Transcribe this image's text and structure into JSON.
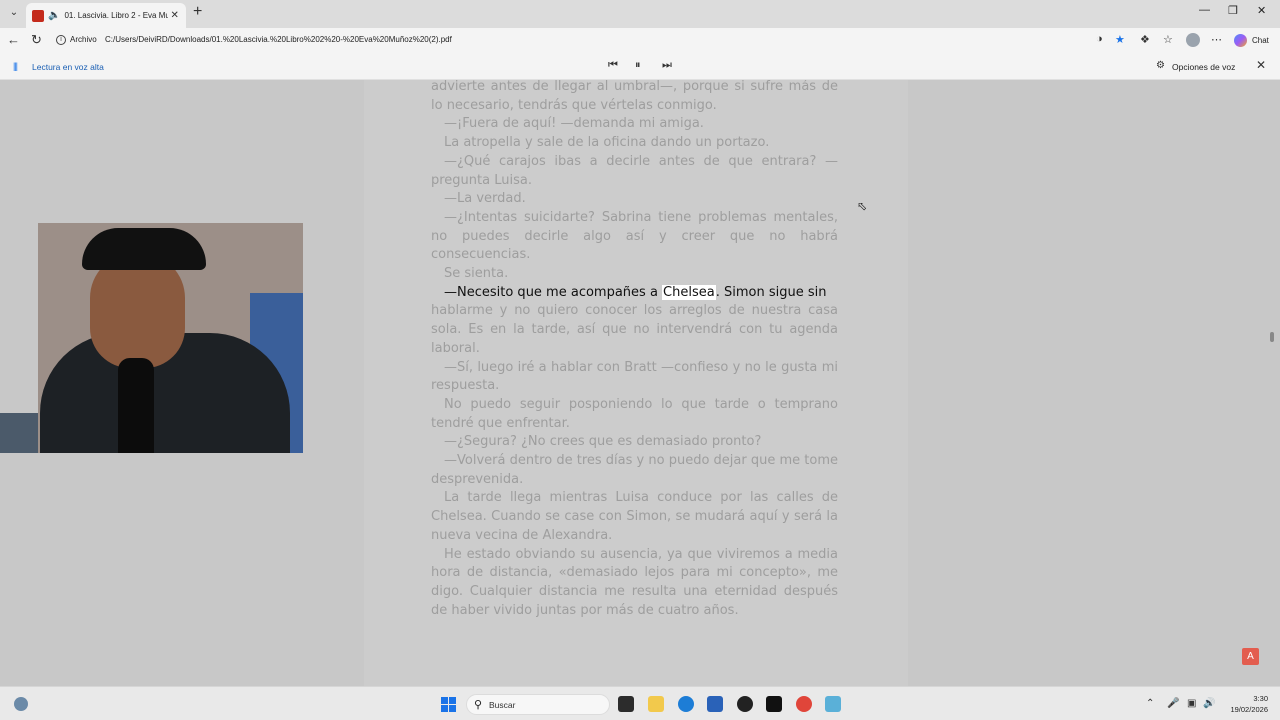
{
  "browser": {
    "tab_title": "01. Lascivia. Libro 2 - Eva Muñ",
    "address_label": "Archivo",
    "url": "C:/Users/DeiviRD/Downloads/01.%20Lascivia.%20Libro%202%20-%20Eva%20Muñoz%20(2).pdf",
    "chat_label": "Chat"
  },
  "read_aloud": {
    "label": "Lectura en voz alta",
    "voice_options": "Opciones de voz"
  },
  "page": {
    "paragraphs": [
      "advierte antes de llegar al umbral—, porque si sufre más de lo necesario, tendrás que vértelas conmigo.",
      "—¡Fuera de aquí! —demanda mi amiga.",
      "La atropella y sale de la oficina dando un portazo.",
      "—¿Qué carajos ibas a decirle antes de que entrara? —pregunta Luisa.",
      "—La verdad.",
      "—¿Intentas suicidarte? Sabrina tiene problemas mentales, no puedes decirle algo así y creer que no habrá consecuencias.",
      "Se sienta."
    ],
    "active_before": "—Necesito que me acompañes a ",
    "active_word": "Chelsea",
    "active_after": ". Simon sigue sin",
    "active_rest": "hablarme y no quiero conocer los arreglos de nuestra casa sola. Es en la tarde, así que no intervendrá con tu agenda laboral.",
    "paragraphs_after": [
      "—Sí, luego iré a hablar con Bratt —confieso y no le gusta mi respuesta.",
      "No puedo seguir posponiendo lo que tarde o temprano tendré que enfrentar.",
      "—¿Segura? ¿No crees que es demasiado pronto?",
      "—Volverá dentro de tres días y no puedo dejar que me tome desprevenida.",
      "La tarde llega mientras Luisa conduce por las calles de Chelsea. Cuando se case con Simon, se mudará aquí y será la nueva vecina de Alexandra.",
      "He estado obviando su ausencia, ya que viviremos a media hora de distancia, «demasiado lejos para mi concepto», me digo. Cualquier distancia me resulta una eternidad después de haber vivido juntas por más de cuatro años."
    ]
  },
  "taskbar": {
    "search_placeholder": "Buscar",
    "time": "3:30",
    "date": "19/02/2026"
  }
}
